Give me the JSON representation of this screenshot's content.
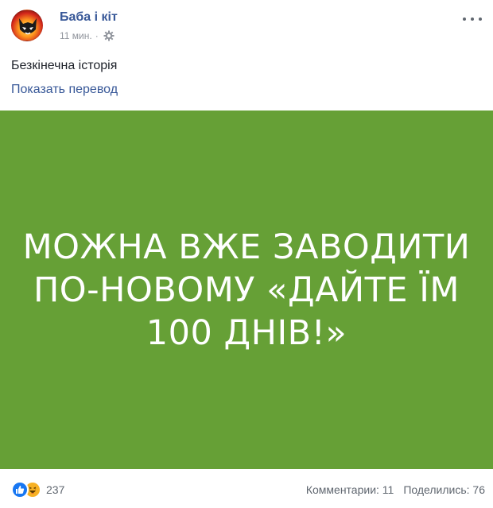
{
  "post": {
    "author": "Баба і кіт",
    "time": "11 мин.",
    "separator": "·",
    "text": "Безкінечна історія",
    "translate_link": "Показать перевод",
    "image_text": "МОЖНА ВЖЕ ЗАВОДИТИ ПО-НОВОМУ «ДАЙТЕ ЇМ 100 ДНІВ!»"
  },
  "footer": {
    "reaction_count": "237",
    "comments": "Комментарии: 11",
    "shares": "Поделились: 76"
  },
  "colors": {
    "link": "#385898",
    "image_bg": "#66a036",
    "like": "#1877f2",
    "haha": "#f7b125"
  },
  "icons": [
    "avatar-logo",
    "privacy-gear-icon",
    "more-options-icon",
    "like-reaction-icon",
    "haha-reaction-icon"
  ]
}
